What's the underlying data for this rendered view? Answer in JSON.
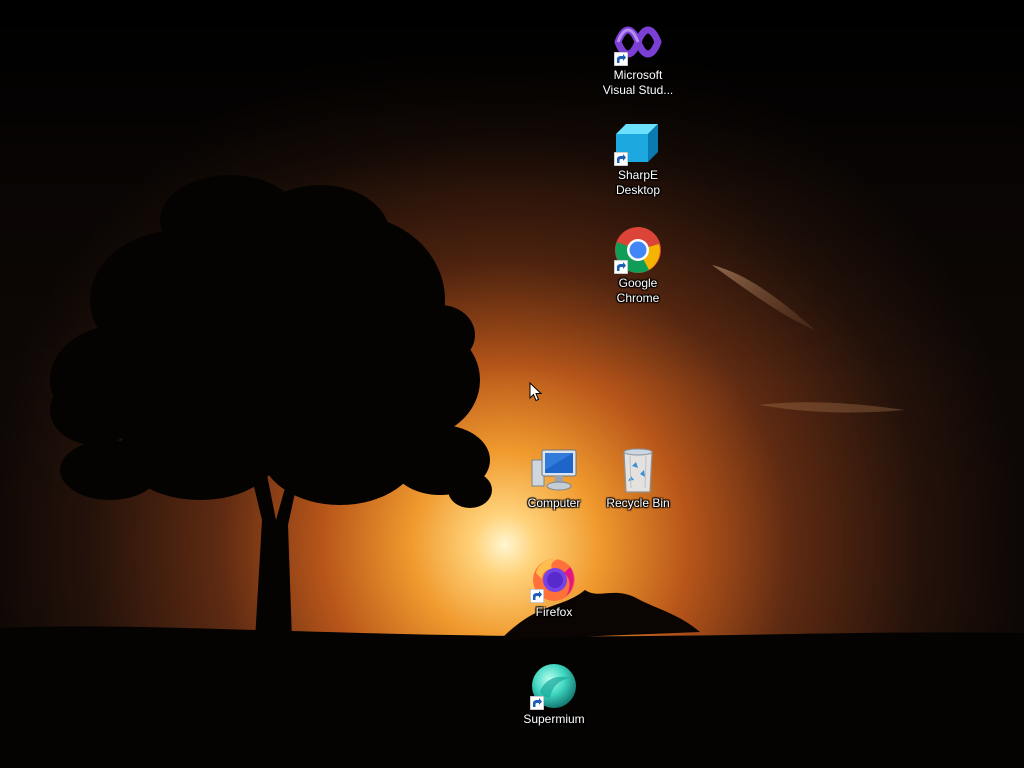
{
  "desktop": {
    "icons": [
      {
        "id": "visual-studio",
        "label": "Microsoft Visual Stud...",
        "icon": "visual-studio-icon",
        "shortcut": true
      },
      {
        "id": "sharpe",
        "label": "SharpE Desktop",
        "icon": "cube-icon",
        "shortcut": true
      },
      {
        "id": "chrome",
        "label": "Google Chrome",
        "icon": "chrome-icon",
        "shortcut": true
      },
      {
        "id": "computer",
        "label": "Computer",
        "icon": "computer-icon",
        "shortcut": false
      },
      {
        "id": "recycle-bin",
        "label": "Recycle Bin",
        "icon": "recycle-bin-icon",
        "shortcut": false
      },
      {
        "id": "firefox",
        "label": "Firefox",
        "icon": "firefox-icon",
        "shortcut": true
      },
      {
        "id": "supermium",
        "label": "Supermium",
        "icon": "supermium-icon",
        "shortcut": true
      }
    ]
  },
  "colors": {
    "sky_top": "#0b0604",
    "sun_glow": "#ffd27a",
    "horizon_orange": "#e0731a",
    "silhouette": "#050302"
  }
}
